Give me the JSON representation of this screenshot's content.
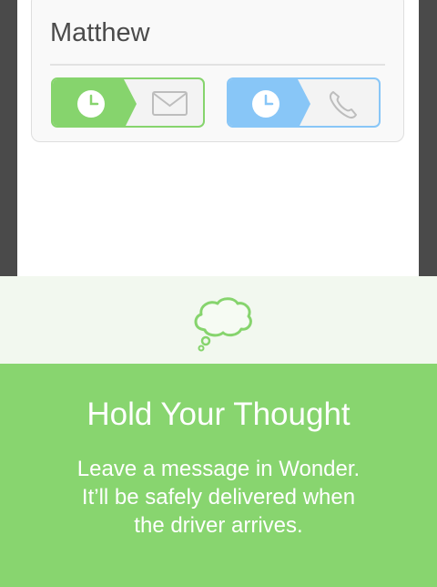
{
  "contact": {
    "name": "Matthew",
    "actions": [
      {
        "type": "message",
        "accent": "#86d46d"
      },
      {
        "type": "call",
        "accent": "#88c6f7"
      }
    ]
  },
  "promo": {
    "title": "Hold Your Thought",
    "body": "Leave a message in Wonder.\nIt’ll be safely delivered when\nthe driver arrives.",
    "icon": "thought-bubble-icon",
    "colors": {
      "panel": "#88d56f",
      "strip": "#f2f8ef"
    }
  }
}
